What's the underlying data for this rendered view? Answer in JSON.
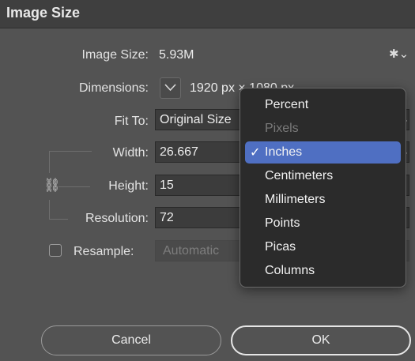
{
  "dialog": {
    "title": "Image Size",
    "gear_icon": "gear-icon"
  },
  "image_size": {
    "label": "Image Size:",
    "value": "5.93M"
  },
  "dimensions": {
    "label": "Dimensions:",
    "value": "1920 px  ×  1080 px"
  },
  "fit_to": {
    "label": "Fit To:",
    "value": "Original Size"
  },
  "width": {
    "label": "Width:",
    "value": "26.667"
  },
  "height": {
    "label": "Height:",
    "value": "15"
  },
  "resolution": {
    "label": "Resolution:",
    "value": "72"
  },
  "resample": {
    "label": "Resample:",
    "value": "Automatic",
    "checked": false
  },
  "buttons": {
    "cancel": "Cancel",
    "ok": "OK"
  },
  "unit_menu": {
    "selected": "Inches",
    "items": [
      {
        "label": "Percent",
        "disabled": false
      },
      {
        "label": "Pixels",
        "disabled": true
      },
      {
        "label": "Inches",
        "disabled": false
      },
      {
        "label": "Centimeters",
        "disabled": false
      },
      {
        "label": "Millimeters",
        "disabled": false
      },
      {
        "label": "Points",
        "disabled": false
      },
      {
        "label": "Picas",
        "disabled": false
      },
      {
        "label": "Columns",
        "disabled": false
      }
    ]
  },
  "colors": {
    "dialog_bg": "#535353",
    "menu_bg": "#2b2b2b",
    "selection": "#4f6fc2"
  }
}
